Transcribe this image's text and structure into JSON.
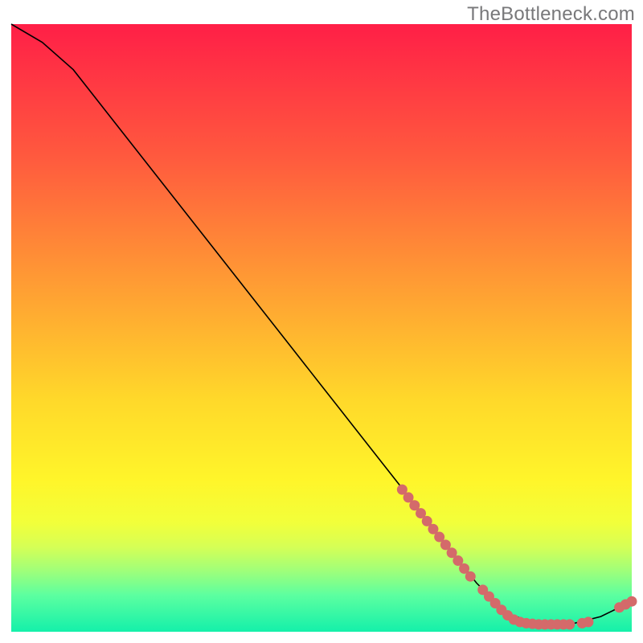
{
  "watermark": "TheBottleneck.com",
  "chart_data": {
    "type": "line",
    "title": "",
    "xlabel": "",
    "ylabel": "",
    "xlim": [
      0,
      100
    ],
    "ylim": [
      0,
      100
    ],
    "grid": false,
    "series": [
      {
        "name": "curve",
        "x": [
          0,
          5,
          10,
          15,
          20,
          25,
          30,
          35,
          40,
          45,
          50,
          55,
          60,
          65,
          70,
          75,
          80,
          85,
          90,
          95,
          100
        ],
        "y": [
          100,
          97,
          92.5,
          86,
          79.5,
          73,
          66.5,
          60,
          53.5,
          47,
          40.5,
          34,
          27.5,
          21,
          14.5,
          8,
          3,
          1.2,
          1.2,
          2.5,
          5
        ]
      }
    ],
    "points": {
      "name": "markers",
      "x": [
        63,
        64,
        65,
        66,
        67,
        68,
        69,
        70,
        71,
        72,
        73,
        74,
        76,
        77,
        78,
        79,
        80,
        81,
        82,
        83,
        84,
        85,
        86,
        87,
        88,
        89,
        90,
        92,
        93,
        98,
        99,
        100
      ],
      "y": [
        23.4,
        22.1,
        20.8,
        19.5,
        18.2,
        16.9,
        15.6,
        14.3,
        13.0,
        11.7,
        10.4,
        9.1,
        6.9,
        5.8,
        4.7,
        3.6,
        2.7,
        2.0,
        1.6,
        1.4,
        1.3,
        1.2,
        1.2,
        1.2,
        1.2,
        1.2,
        1.2,
        1.4,
        1.6,
        4.0,
        4.5,
        5.0
      ]
    }
  }
}
